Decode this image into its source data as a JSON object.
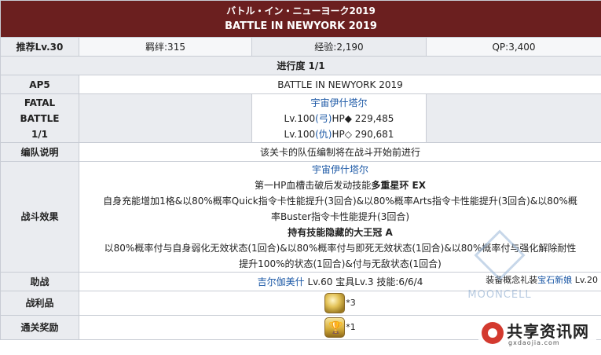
{
  "header": {
    "title_jp": "バトル・イン・ニューヨーク2019",
    "title_en": "BATTLE IN NEWYORK 2019"
  },
  "row_rec": {
    "label": "推荐Lv.30",
    "bond": "羁绊:315",
    "exp": "经验:2,190",
    "qp": "QP:3,400"
  },
  "progress": "进行度 1/1",
  "row_ap": {
    "label": "AP5",
    "value": "BATTLE IN NEWYORK 2019"
  },
  "row_fatal": {
    "label_lines": [
      "FATAL",
      "BATTLE",
      "1/1"
    ],
    "enemy_name": "宇宙伊什塔尔",
    "line1_pre": "Lv.100",
    "line1_class": "(弓)",
    "line1_post": "HP◆ 229,485",
    "line2_pre": "Lv.100",
    "line2_class": "(仇)",
    "line2_post": "HP◇ 290,681"
  },
  "row_team": {
    "label": "编队说明",
    "text": "该关卡的队伍编制将在战斗开始前进行"
  },
  "row_effect": {
    "label": "战斗效果",
    "name": "宇宙伊什塔尔",
    "l1_pre": "第一HP血槽击破后发动技能",
    "l1_bold": "多重星环 EX",
    "l2": "自身充能增加1格&以80%概率Quick指令卡性能提升(3回合)&以80%概率Arts指令卡性能提升(3回合)&以80%概",
    "l3": "率Buster指令卡性能提升(3回合)",
    "l4_pre": "持有技能",
    "l4_bold": "隐藏的大王冠 A",
    "l5": "以80%概率付与自身弱化无效状态(1回合)&以80%概率付与即死无效状态(1回合)&以80%概率付与强化解除耐性",
    "l6": "提升100%的状态(1回合)&付与无敌状态(1回合)"
  },
  "row_support": {
    "label": "助战",
    "name": "吉尔伽美什",
    "detail": " Lv.60 宝具Lv.3 技能:6/6/4",
    "ce_pre": "装备概念礼装",
    "ce_name": "宝石新娘",
    "ce_post": " Lv.20"
  },
  "row_drops": {
    "label": "战利品",
    "count": "*3",
    "icon": "gold-orb-icon"
  },
  "row_reward": {
    "label": "通关奖励",
    "count": "*1",
    "icon": "gold-cup-icon"
  },
  "watermarks": {
    "mooncell": "MOONCELL",
    "site_name": "共享资讯网",
    "site_domain": "gxdaojia.com"
  }
}
